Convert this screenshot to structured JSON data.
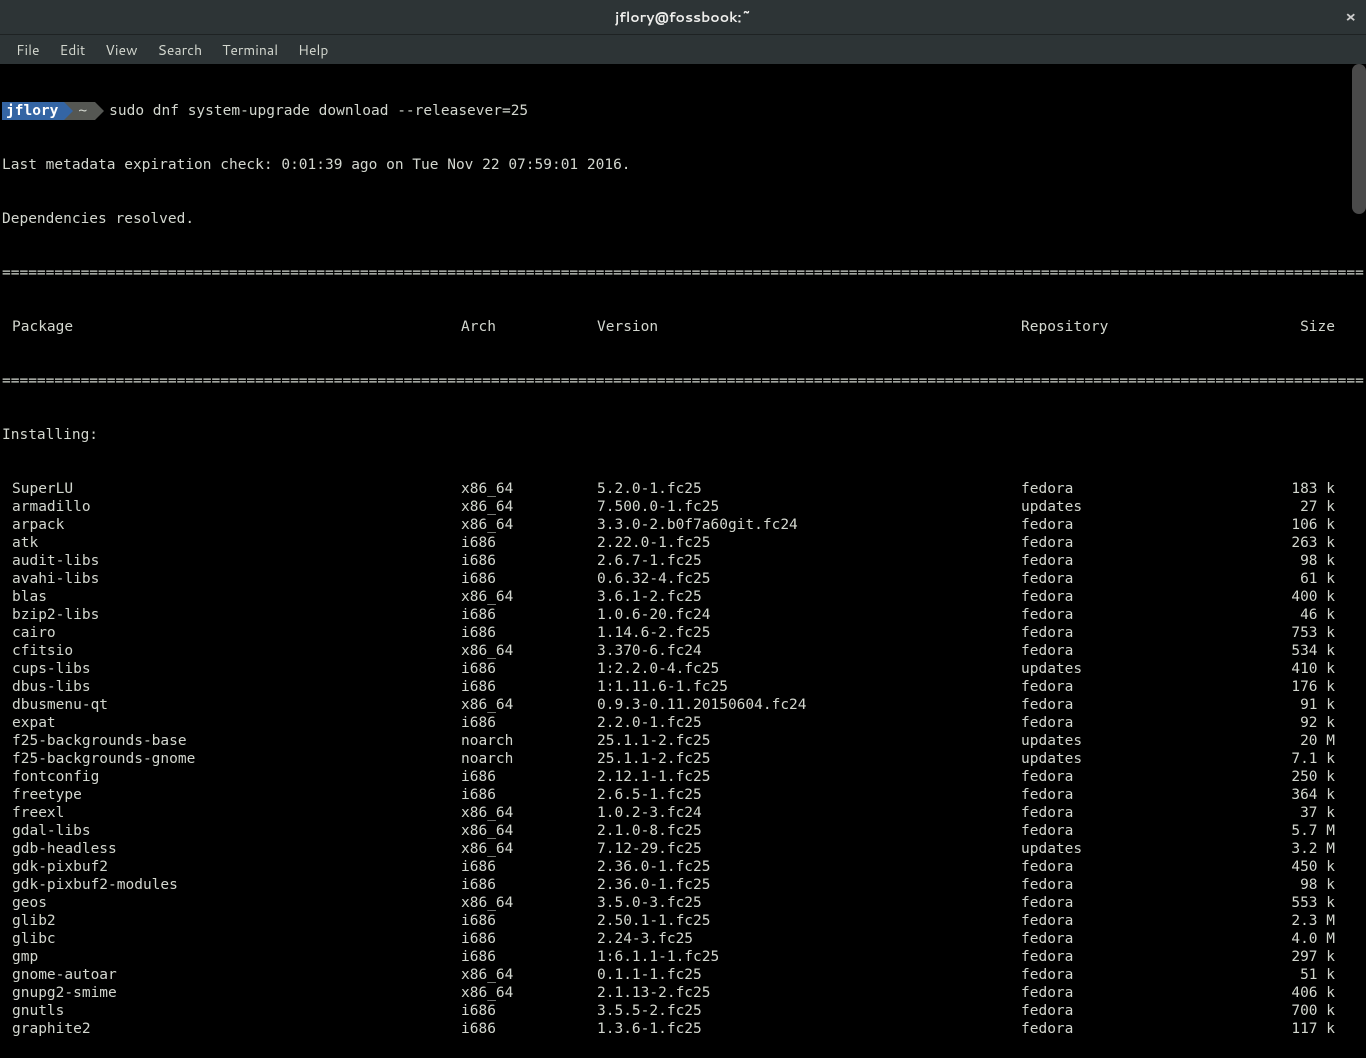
{
  "window": {
    "title": "jflory@fossbook:~",
    "close": "×"
  },
  "menu": {
    "file": "File",
    "edit": "Edit",
    "view": "View",
    "search": "Search",
    "terminal": "Terminal",
    "help": "Help"
  },
  "prompt": {
    "user": "jflory",
    "path": "~",
    "command": "sudo dnf system-upgrade download --releasever=25"
  },
  "output": {
    "metadata_line": "Last metadata expiration check: 0:01:39 ago on Tue Nov 22 07:59:01 2016.",
    "deps_resolved": "Dependencies resolved.",
    "installing": "Installing:",
    "separator": "================================================================================================================================================================================================================"
  },
  "headers": {
    "package": "Package",
    "arch": "Arch",
    "version": "Version",
    "repository": "Repository",
    "size": "Size"
  },
  "packages": [
    {
      "name": "SuperLU",
      "arch": "x86_64",
      "version": "5.2.0-1.fc25",
      "repo": "fedora",
      "size": "183 k"
    },
    {
      "name": "armadillo",
      "arch": "x86_64",
      "version": "7.500.0-1.fc25",
      "repo": "updates",
      "size": "27 k"
    },
    {
      "name": "arpack",
      "arch": "x86_64",
      "version": "3.3.0-2.b0f7a60git.fc24",
      "repo": "fedora",
      "size": "106 k"
    },
    {
      "name": "atk",
      "arch": "i686",
      "version": "2.22.0-1.fc25",
      "repo": "fedora",
      "size": "263 k"
    },
    {
      "name": "audit-libs",
      "arch": "i686",
      "version": "2.6.7-1.fc25",
      "repo": "fedora",
      "size": "98 k"
    },
    {
      "name": "avahi-libs",
      "arch": "i686",
      "version": "0.6.32-4.fc25",
      "repo": "fedora",
      "size": "61 k"
    },
    {
      "name": "blas",
      "arch": "x86_64",
      "version": "3.6.1-2.fc25",
      "repo": "fedora",
      "size": "400 k"
    },
    {
      "name": "bzip2-libs",
      "arch": "i686",
      "version": "1.0.6-20.fc24",
      "repo": "fedora",
      "size": "46 k"
    },
    {
      "name": "cairo",
      "arch": "i686",
      "version": "1.14.6-2.fc25",
      "repo": "fedora",
      "size": "753 k"
    },
    {
      "name": "cfitsio",
      "arch": "x86_64",
      "version": "3.370-6.fc24",
      "repo": "fedora",
      "size": "534 k"
    },
    {
      "name": "cups-libs",
      "arch": "i686",
      "version": "1:2.2.0-4.fc25",
      "repo": "updates",
      "size": "410 k"
    },
    {
      "name": "dbus-libs",
      "arch": "i686",
      "version": "1:1.11.6-1.fc25",
      "repo": "fedora",
      "size": "176 k"
    },
    {
      "name": "dbusmenu-qt",
      "arch": "x86_64",
      "version": "0.9.3-0.11.20150604.fc24",
      "repo": "fedora",
      "size": "91 k"
    },
    {
      "name": "expat",
      "arch": "i686",
      "version": "2.2.0-1.fc25",
      "repo": "fedora",
      "size": "92 k"
    },
    {
      "name": "f25-backgrounds-base",
      "arch": "noarch",
      "version": "25.1.1-2.fc25",
      "repo": "updates",
      "size": "20 M"
    },
    {
      "name": "f25-backgrounds-gnome",
      "arch": "noarch",
      "version": "25.1.1-2.fc25",
      "repo": "updates",
      "size": "7.1 k"
    },
    {
      "name": "fontconfig",
      "arch": "i686",
      "version": "2.12.1-1.fc25",
      "repo": "fedora",
      "size": "250 k"
    },
    {
      "name": "freetype",
      "arch": "i686",
      "version": "2.6.5-1.fc25",
      "repo": "fedora",
      "size": "364 k"
    },
    {
      "name": "freexl",
      "arch": "x86_64",
      "version": "1.0.2-3.fc24",
      "repo": "fedora",
      "size": "37 k"
    },
    {
      "name": "gdal-libs",
      "arch": "x86_64",
      "version": "2.1.0-8.fc25",
      "repo": "fedora",
      "size": "5.7 M"
    },
    {
      "name": "gdb-headless",
      "arch": "x86_64",
      "version": "7.12-29.fc25",
      "repo": "updates",
      "size": "3.2 M"
    },
    {
      "name": "gdk-pixbuf2",
      "arch": "i686",
      "version": "2.36.0-1.fc25",
      "repo": "fedora",
      "size": "450 k"
    },
    {
      "name": "gdk-pixbuf2-modules",
      "arch": "i686",
      "version": "2.36.0-1.fc25",
      "repo": "fedora",
      "size": "98 k"
    },
    {
      "name": "geos",
      "arch": "x86_64",
      "version": "3.5.0-3.fc25",
      "repo": "fedora",
      "size": "553 k"
    },
    {
      "name": "glib2",
      "arch": "i686",
      "version": "2.50.1-1.fc25",
      "repo": "fedora",
      "size": "2.3 M"
    },
    {
      "name": "glibc",
      "arch": "i686",
      "version": "2.24-3.fc25",
      "repo": "fedora",
      "size": "4.0 M"
    },
    {
      "name": "gmp",
      "arch": "i686",
      "version": "1:6.1.1-1.fc25",
      "repo": "fedora",
      "size": "297 k"
    },
    {
      "name": "gnome-autoar",
      "arch": "x86_64",
      "version": "0.1.1-1.fc25",
      "repo": "fedora",
      "size": "51 k"
    },
    {
      "name": "gnupg2-smime",
      "arch": "x86_64",
      "version": "2.1.13-2.fc25",
      "repo": "fedora",
      "size": "406 k"
    },
    {
      "name": "gnutls",
      "arch": "i686",
      "version": "3.5.5-2.fc25",
      "repo": "fedora",
      "size": "700 k"
    },
    {
      "name": "graphite2",
      "arch": "i686",
      "version": "1.3.6-1.fc25",
      "repo": "fedora",
      "size": "117 k"
    }
  ]
}
